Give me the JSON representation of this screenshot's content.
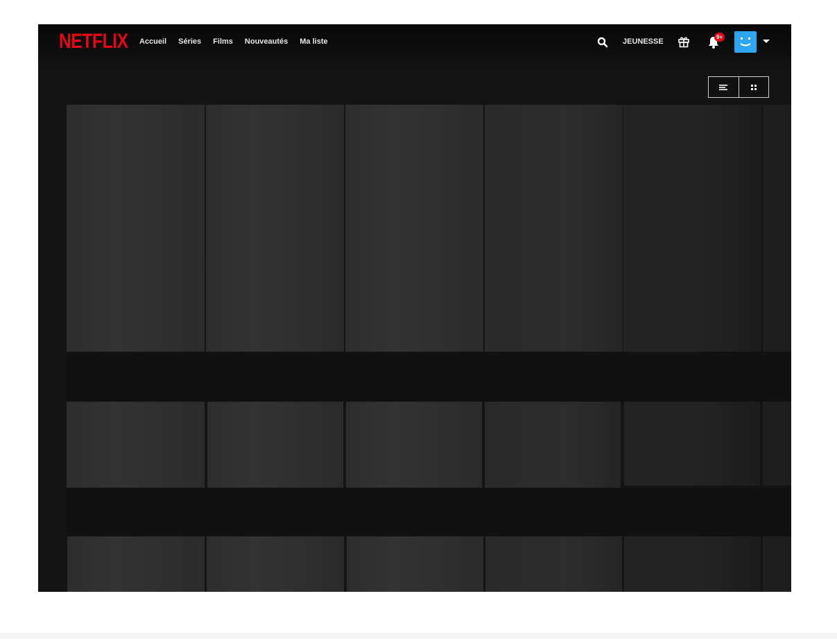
{
  "brand": {
    "logo_text": "NETFLIX",
    "logo_color": "#e50914"
  },
  "nav": {
    "links": [
      "Accueil",
      "Séries",
      "Films",
      "Nouveautés",
      "Ma liste"
    ]
  },
  "secondary_nav": {
    "kids_label": "JEUNESSE",
    "notification_badge": "9+",
    "search_icon": "search-icon",
    "gift_icon": "gift-icon",
    "bell_icon": "bell-icon",
    "avatar_color": "#2ea5f0"
  },
  "view_toggle": {
    "options": [
      "list-view-icon",
      "grid-view-icon"
    ]
  },
  "content": {
    "rows": [
      {
        "tile_count": 6,
        "state": "loading-placeholder"
      },
      {
        "tile_count": 6,
        "state": "loading-placeholder"
      },
      {
        "tile_count": 6,
        "state": "loading-placeholder"
      }
    ]
  }
}
